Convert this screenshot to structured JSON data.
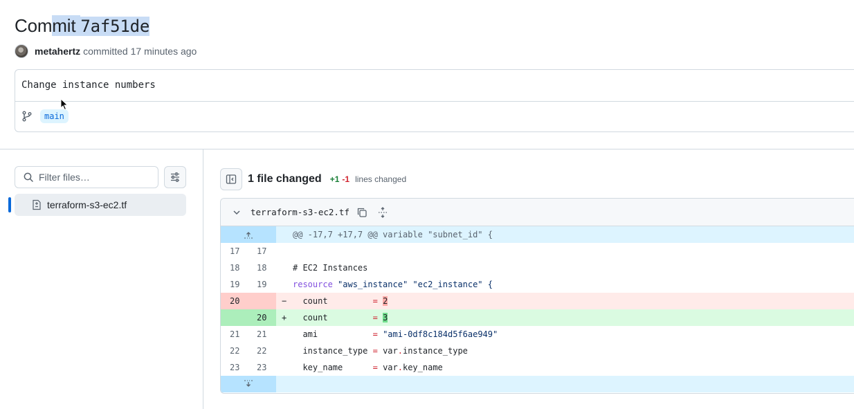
{
  "header": {
    "title_prefix": "Com",
    "title_hl": "mit ",
    "sha": "7af51de",
    "author": "metahertz",
    "committed_text": "committed 17 minutes ago"
  },
  "commit": {
    "message": "Change instance numbers",
    "branch": "main"
  },
  "sidebar": {
    "filter_placeholder": "Filter files…",
    "files": [
      {
        "name": "terraform-s3-ec2.tf"
      }
    ]
  },
  "summary": {
    "files_changed": "1 file changed",
    "additions": "+1",
    "deletions": "-1",
    "lines_changed": "lines changed"
  },
  "diff": {
    "file_name": "terraform-s3-ec2.tf",
    "hunk_header": "@@ -17,7 +17,7 @@ variable \"subnet_id\" {",
    "lines": [
      {
        "old": "17",
        "new": "17",
        "sign": "",
        "text": ""
      },
      {
        "old": "18",
        "new": "18",
        "sign": "",
        "text": "# EC2 Instances"
      },
      {
        "old": "19",
        "new": "19",
        "sign": "",
        "text_kw": "resource",
        "text_rest": " \"aws_instance\" \"ec2_instance\" {"
      },
      {
        "old": "20",
        "new": "",
        "sign": "−",
        "key": "  count         ",
        "eq": "=",
        "val": "2"
      },
      {
        "old": "",
        "new": "20",
        "sign": "+",
        "key": "  count         ",
        "eq": "=",
        "val": "3"
      },
      {
        "old": "21",
        "new": "21",
        "sign": "",
        "key": "  ami           ",
        "eq": "=",
        "val": "\"ami-0df8c184d5f6ae949\""
      },
      {
        "old": "22",
        "new": "22",
        "sign": "",
        "key": "  instance_type ",
        "eq": "=",
        "val_a": "var",
        "dot": ".",
        "val_b": "instance_type"
      },
      {
        "old": "23",
        "new": "23",
        "sign": "",
        "key": "  key_name      ",
        "eq": "=",
        "val_a": "var",
        "dot": ".",
        "val_b": "key_name"
      }
    ]
  }
}
